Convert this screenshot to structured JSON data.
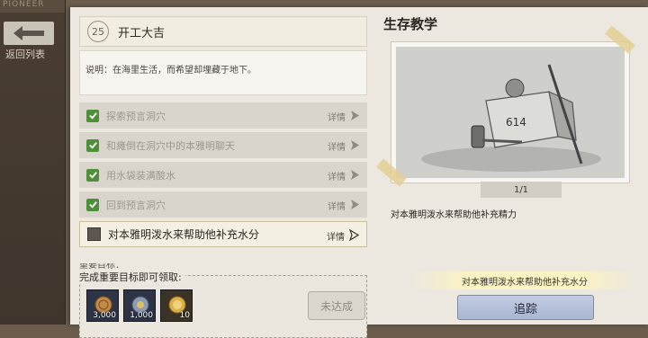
{
  "sidebar": {
    "header_text": "PIONEER",
    "back_label": "返回列表"
  },
  "quest": {
    "number": "25",
    "title": "开工大吉",
    "description": "说明：在海里生活，而希望却埋藏于地下。"
  },
  "tasks": [
    {
      "label": "探索预言洞穴",
      "detail": "详情",
      "done": true
    },
    {
      "label": "和瘫倒在洞穴中的本雅明聊天",
      "detail": "详情",
      "done": true
    },
    {
      "label": "用水袋装满酸水",
      "detail": "详情",
      "done": true
    },
    {
      "label": "回到预言洞穴",
      "detail": "详情",
      "done": true
    },
    {
      "label": "对本雅明泼水来帮助他补充水分",
      "detail": "详情",
      "done": false
    }
  ],
  "cut_text": "重要目标：",
  "reward": {
    "title": "完成重要目标即可领取:",
    "items": [
      {
        "icon": "coin-icon",
        "qty": "3,000"
      },
      {
        "icon": "gear-coin-icon",
        "qty": "1,000"
      },
      {
        "icon": "gold-coin-icon",
        "qty": "10"
      }
    ],
    "button_label": "未达成"
  },
  "tutorial": {
    "title": "生存教学",
    "page": "1/1",
    "crate_text": "614",
    "tip": "对本雅明泼水来帮助他补充精力"
  },
  "objective_hint": "对本雅明泼水来帮助他补充水分",
  "track_label": "追踪"
}
